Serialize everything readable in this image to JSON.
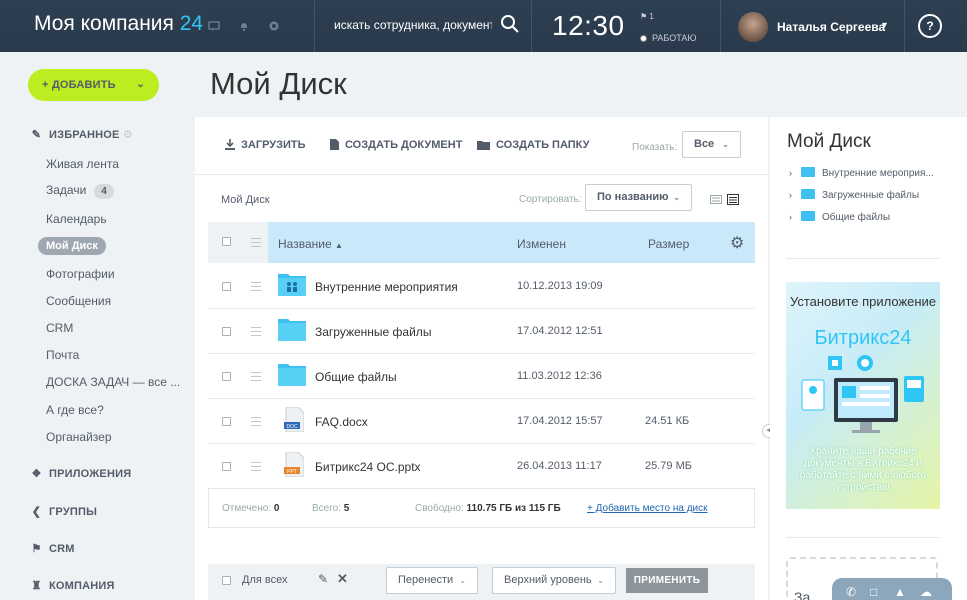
{
  "header": {
    "logo_main": "Моя компания",
    "logo_num": "24",
    "search_placeholder": "искать сотрудника, документ, пр",
    "clock": "12:30",
    "flag_count": "1",
    "status": "РАБОТАЮ",
    "user_name": "Наталья Сергеева",
    "help": "?"
  },
  "sidebar": {
    "add_button": "+ ДОБАВИТЬ",
    "favorites": "ИЗБРАННОЕ",
    "items": [
      {
        "label": "Живая лента"
      },
      {
        "label": "Задачи",
        "badge": "4"
      },
      {
        "label": "Календарь"
      },
      {
        "label": "Мой Диск"
      },
      {
        "label": "Фотографии"
      },
      {
        "label": "Сообщения"
      },
      {
        "label": "CRM"
      },
      {
        "label": "Почта"
      },
      {
        "label": "ДОСКА ЗАДАЧ — все ..."
      },
      {
        "label": "А где все?"
      },
      {
        "label": "Органайзер"
      }
    ],
    "sections": [
      "ПРИЛОЖЕНИЯ",
      "ГРУППЫ",
      "CRM",
      "КОМПАНИЯ"
    ]
  },
  "main": {
    "title": "Мой Диск",
    "toolbar": {
      "upload": "ЗАГРУЗИТЬ",
      "create_doc": "СОЗДАТЬ ДОКУМЕНТ",
      "create_folder": "СОЗДАТЬ ПАПКУ",
      "show_label": "Показать:",
      "show_value": "Все"
    },
    "breadcrumb": "Мой Диск",
    "sort_label": "Сортировать:",
    "sort_value": "По названию",
    "columns": {
      "name": "Название",
      "modified": "Изменен",
      "size": "Размер"
    },
    "rows": [
      {
        "name": "Внутренние мероприятия",
        "modified": "10.12.2013 19:09",
        "size": "",
        "type": "folder-shared"
      },
      {
        "name": "Загруженные файлы",
        "modified": "17.04.2012 12:51",
        "size": "",
        "type": "folder"
      },
      {
        "name": "Общие файлы",
        "modified": "11.03.2012 12:36",
        "size": "",
        "type": "folder"
      },
      {
        "name": "FAQ.docx",
        "modified": "17.04.2012 15:57",
        "size": "24.51 КБ",
        "type": "doc",
        "ext": "DOC"
      },
      {
        "name": "Битрикс24 ОС.pptx",
        "modified": "26.04.2013 11:17",
        "size": "25.79 МБ",
        "type": "ppt",
        "ext": "PPT"
      }
    ],
    "footer": {
      "marked_label": "Отмечено:",
      "marked_value": "0",
      "total_label": "Всего:",
      "total_value": "5",
      "free_label": "Свободно:",
      "free_value": "110.75 ГБ из 115 ГБ",
      "add_space": "+ Добавить место на диск"
    },
    "actions": {
      "for_all": "Для всех",
      "move": "Перенести",
      "level": "Верхний уровень",
      "apply": "ПРИМЕНИТЬ"
    }
  },
  "right_panel": {
    "title": "Мой Диск",
    "tree": [
      "Внутренние мероприя...",
      "Загруженные файлы",
      "Общие файлы"
    ],
    "banner": {
      "line1": "Установите приложение",
      "brand": "Битрикс24",
      "text": "Храните ваши рабочие документы в Битрикс24 и работайте с ними с любого устройства!"
    },
    "drop_text": "За"
  },
  "colors": {
    "accent": "#2fc6f6",
    "add_button": "#bbed21",
    "topbar": "#2c3e50"
  }
}
